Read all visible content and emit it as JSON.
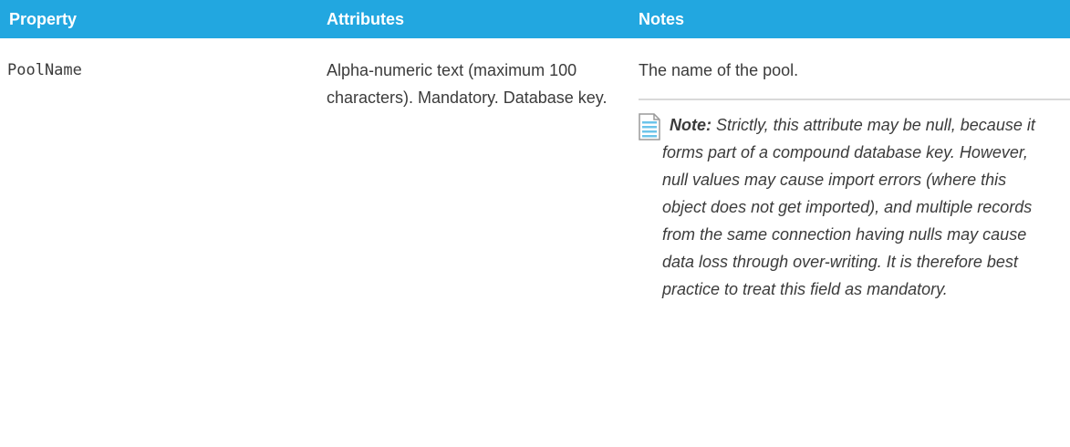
{
  "table": {
    "headers": {
      "property": "Property",
      "attributes": "Attributes",
      "notes": "Notes"
    },
    "rows": [
      {
        "property": "PoolName",
        "attributes": "Alpha-numeric text (maximum 100 characters). Mandatory. Database key.",
        "notes_description": "The name of the pool.",
        "note_label": "Note:",
        "note_text": "Strictly, this attribute may be null, because it forms part of a compound database key. However, null values may cause import errors (where this object does not get imported), and multiple records from the same connection having nulls may cause data loss through over-writing. It is therefore best practice to treat this field as mandatory."
      }
    ]
  },
  "colors": {
    "header_background": "#22a7e0",
    "header_text": "#ffffff",
    "body_text": "#3b3b3b",
    "note_divider": "#d9d9d9",
    "note_icon_accent": "#6cc4ea"
  },
  "icons": {
    "note": "note-document-icon"
  }
}
